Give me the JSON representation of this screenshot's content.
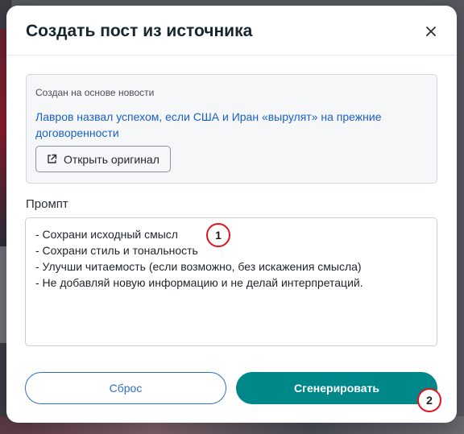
{
  "modal": {
    "title": "Создать пост из источника",
    "close_icon": "close-icon"
  },
  "source": {
    "caption": "Создан на основе новости",
    "link_text": "Лавров назвал успехом, если США и Иран «вырулят» на прежние договоренности",
    "open_original_label": "Открыть оригинал",
    "open_original_icon": "external-link-icon"
  },
  "prompt": {
    "label": "Промпт",
    "lines": [
      "- Сохрани исходный смысл",
      "- Сохрани стиль и тональность",
      "- Улучши читаемость (если возможно, без искажения смысла)",
      "- Не добавляй новую информацию и не делай интерпретаций."
    ]
  },
  "actions": {
    "reset_label": "Сброс",
    "generate_label": "Сгенерировать"
  },
  "annotations": {
    "marker_1": "1",
    "marker_2": "2"
  },
  "colors": {
    "accent": "#00878a",
    "link": "#1a5fc7",
    "marker_border": "#e0141e"
  }
}
